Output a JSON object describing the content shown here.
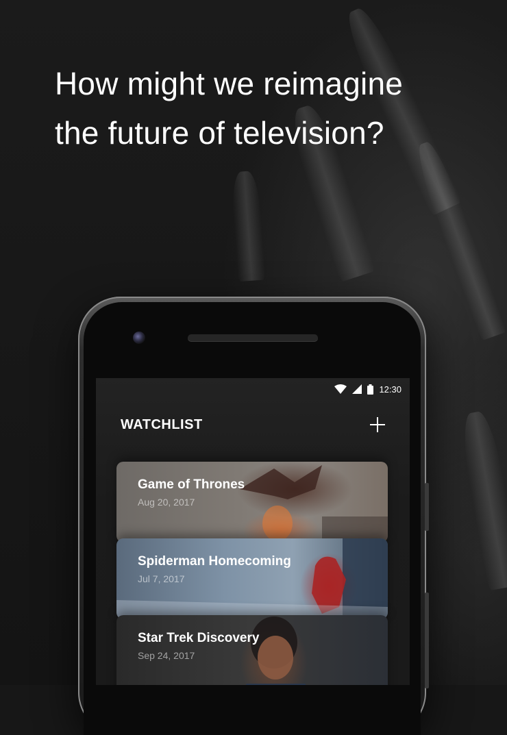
{
  "headline": "How might we reimagine the future of television?",
  "status_bar": {
    "time": "12:30",
    "wifi_icon": "wifi-icon",
    "signal_icon": "signal-icon",
    "battery_icon": "battery-icon"
  },
  "watchlist": {
    "title": "WATCHLIST",
    "add_icon": "plus-icon",
    "items": [
      {
        "title": "Game of Thrones",
        "date": "Aug 20, 2017"
      },
      {
        "title": "Spiderman Homecoming",
        "date": "Jul 7, 2017"
      },
      {
        "title": "Star Trek Discovery",
        "date": "Sep 24, 2017"
      }
    ]
  }
}
